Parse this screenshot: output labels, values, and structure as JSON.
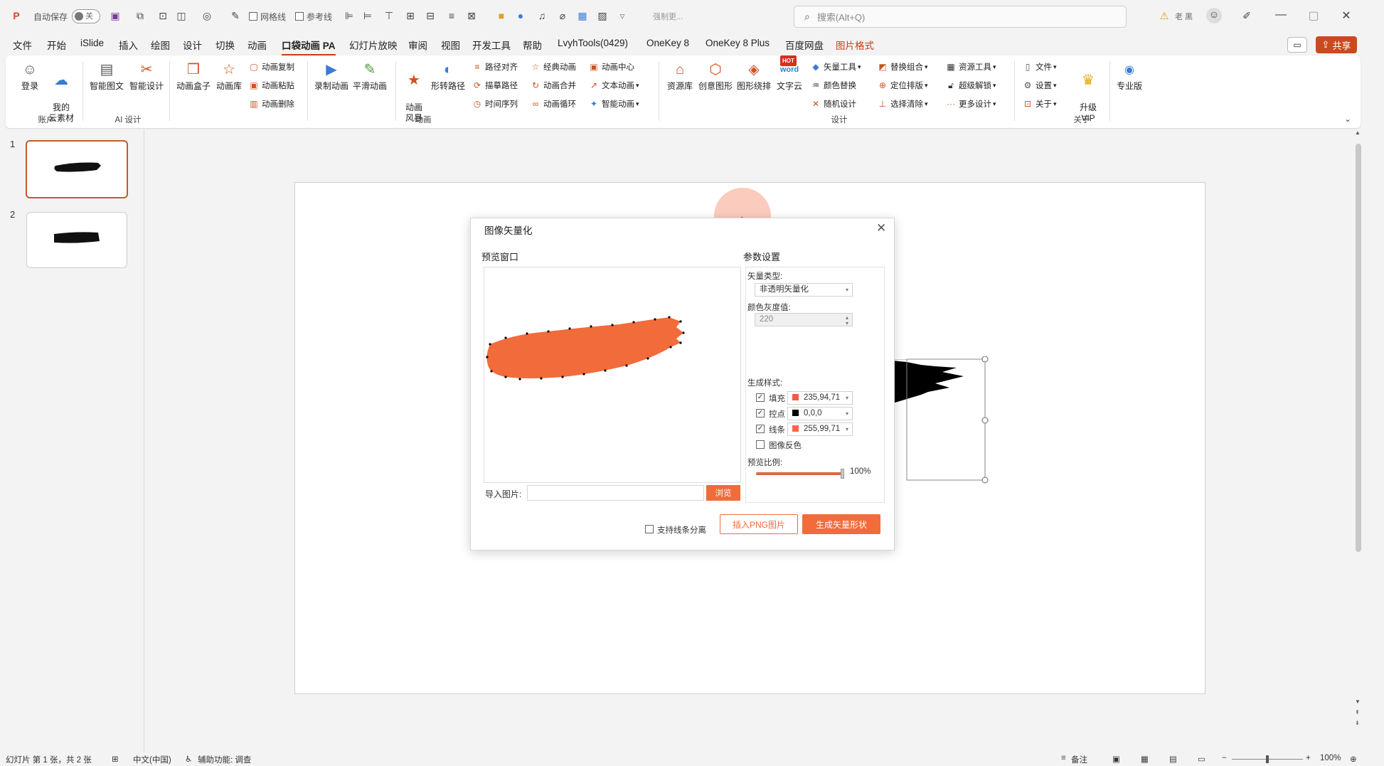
{
  "titlebar": {
    "autosave_label": "自动保存",
    "autosave_state": "关",
    "gridlines_label": "网格线",
    "guides_label": "参考线",
    "doc_title": "强制更...",
    "search_placeholder": "搜索(Alt+Q)",
    "user_name": "老 黑"
  },
  "tabs": [
    "文件",
    "开始",
    "iSlide",
    "插入",
    "绘图",
    "设计",
    "切换",
    "动画",
    "口袋动画 PA",
    "幻灯片放映",
    "审阅",
    "视图",
    "开发工具",
    "帮助",
    "LvyhTools(0429)",
    "OneKey 8",
    "OneKey 8 Plus",
    "百度网盘",
    "图片格式"
  ],
  "share_label": "共享",
  "ribbon": {
    "account": {
      "login": "登录",
      "my_assets": "我的\n云素材",
      "group": "账户"
    },
    "ai": {
      "smart_text": "智能图文",
      "smart_design": "智能设计",
      "group": "AI 设计"
    },
    "anim_box": "动画盒子",
    "anim_lib": "动画库",
    "anim_copy": "动画复制",
    "anim_paste": "动画粘贴",
    "anim_delete": "动画删除",
    "record_anim": "录制动画",
    "smooth_anim": "平滑动画",
    "anim_style": "动画\n风暴",
    "morph_path": "形转路径",
    "path_align": "路径对齐",
    "draw_path": "描摹路径",
    "time_series": "时间序列",
    "classic_anim": "经典动画",
    "anim_merge": "动画合并",
    "anim_loop": "动画循环",
    "anim_center": "动画中心",
    "text_anim": "文本动画",
    "smart_anim": "智能动画",
    "group_anim": "动画",
    "resource_lib": "资源库",
    "creative_shape": "创意图形",
    "shape_surround": "图形绕排",
    "word_cloud": "文字云",
    "vector_tools": "矢量工具",
    "color_replace": "颜色替换",
    "random_design": "随机设计",
    "replace_combo": "替换组合",
    "locate_layout": "定位排版",
    "select_clear": "选择清除",
    "resource_tools": "资源工具",
    "super_unlock": "超级解锁",
    "more_design": "更多设计",
    "group_design": "设计",
    "file": "文件",
    "settings": "设置",
    "about": "关于",
    "upgrade": "升级\nVIP",
    "pro": "专业版",
    "group_about": "关于",
    "hot_badge": "HOT",
    "word_badge": "word"
  },
  "thumbnails": [
    "1",
    "2"
  ],
  "dialog": {
    "title": "图像矢量化",
    "preview_label": "预览窗口",
    "params_label": "参数设置",
    "vector_type_label": "矢量类型:",
    "vector_type_value": "非透明矢量化",
    "gray_label": "颜色灰度值:",
    "gray_value": "220",
    "style_label": "生成样式:",
    "fill_label": "填充",
    "fill_value": "235,94,71",
    "fill_color": "#eb5e47",
    "point_label": "控点",
    "point_value": "0,0,0",
    "point_color": "#000000",
    "line_label": "线条",
    "line_value": "255,99,71",
    "line_color": "#ff6347",
    "invert_label": "图像反色",
    "ratio_label": "预览比例:",
    "ratio_value": "100%",
    "ratio_fraction": 1.0,
    "import_label": "导入图片:",
    "browse_label": "浏览",
    "split_label": "支持线条分离",
    "insert_png_label": "插入PNG图片",
    "generate_label": "生成矢量形状",
    "accent": "#f26b3a"
  },
  "status": {
    "slide_info": "幻灯片 第 1 张，共 2 张",
    "language": "中文(中国)",
    "accessibility": "辅助功能: 调查",
    "notes": "备注",
    "zoom": "100%"
  }
}
